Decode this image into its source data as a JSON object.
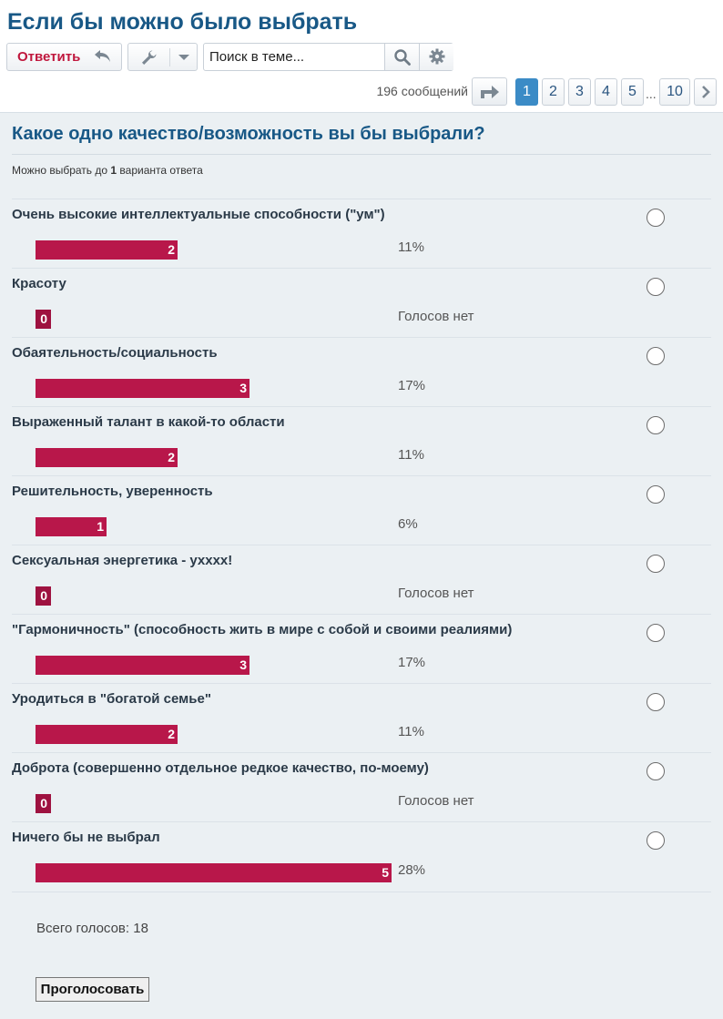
{
  "thread": {
    "title": "Если бы можно было выбрать"
  },
  "toolbar": {
    "reply_label": "Ответить",
    "search_placeholder": "Поиск в теме..."
  },
  "pagination": {
    "message_count": "196 сообщений",
    "pages": [
      "1",
      "2",
      "3",
      "4",
      "5"
    ],
    "ellipsis": "...",
    "last_page": "10",
    "current_page": "1"
  },
  "poll": {
    "question": "Какое одно качество/возможность вы бы выбрали?",
    "hint_prefix": "Можно выбрать до ",
    "hint_count": "1",
    "hint_suffix": " варианта ответа",
    "options": [
      {
        "label": "Очень высокие интеллектуальные способности (\"ум\")",
        "votes": 2,
        "votes_text": "2",
        "share": "11%",
        "fill": 0.4
      },
      {
        "label": "Красоту",
        "votes": 0,
        "votes_text": "0",
        "share": "Голосов нет",
        "fill": 0
      },
      {
        "label": "Обаятельность/социальность",
        "votes": 3,
        "votes_text": "3",
        "share": "17%",
        "fill": 0.6
      },
      {
        "label": "Выраженный талант в какой-то области",
        "votes": 2,
        "votes_text": "2",
        "share": "11%",
        "fill": 0.4
      },
      {
        "label": "Решительность, уверенность",
        "votes": 1,
        "votes_text": "1",
        "share": "6%",
        "fill": 0.2
      },
      {
        "label": "Сексуальная энергетика - ухххх!",
        "votes": 0,
        "votes_text": "0",
        "share": "Голосов нет",
        "fill": 0
      },
      {
        "label": "\"Гармоничность\" (способность жить в мире с собой и своими реалиями)",
        "votes": 3,
        "votes_text": "3",
        "share": "17%",
        "fill": 0.6
      },
      {
        "label": "Уродиться в \"богатой семье\"",
        "votes": 2,
        "votes_text": "2",
        "share": "11%",
        "fill": 0.4
      },
      {
        "label": "Доброта (совершенно отдельное редкое качество, по-моему)",
        "votes": 0,
        "votes_text": "0",
        "share": "Голосов нет",
        "fill": 0
      },
      {
        "label": "Ничего бы не выбрал",
        "votes": 5,
        "votes_text": "5",
        "share": "28%",
        "fill": 1.0
      }
    ],
    "total_votes": "Всего голосов: 18",
    "vote_button": "Проголосовать"
  },
  "colors": {
    "title": "#185886",
    "bar": "#b8174a",
    "accent": "#3b8bc6",
    "reply": "#c0173d"
  },
  "icons": [
    "reply-arrow-icon",
    "wrench-icon",
    "caret-down-icon",
    "search-icon",
    "gear-icon",
    "goto-arrow-icon",
    "chevron-right-icon"
  ]
}
